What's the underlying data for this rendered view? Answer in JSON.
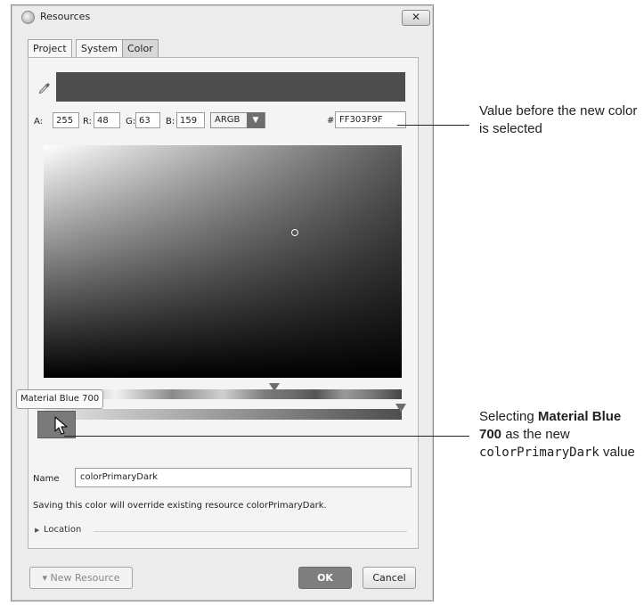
{
  "window": {
    "title": "Resources",
    "close_label": "✕"
  },
  "tabs": [
    {
      "label": "Project"
    },
    {
      "label": "System"
    },
    {
      "label": "Color",
      "selected": true
    }
  ],
  "color_picker": {
    "preview_color": "#4e4e4e",
    "channels": {
      "a_label": "A:",
      "a_value": "255",
      "r_label": "R:",
      "r_value": "48",
      "g_label": "G:",
      "g_value": "63",
      "b_label": "B:",
      "b_value": "159"
    },
    "mode": "ARGB",
    "hash_label": "#",
    "hex_value": "FF303F9F"
  },
  "tooltip": "Material Blue 700",
  "name_label": "Name",
  "name_value": "colorPrimaryDark",
  "warning_text": "Saving this color will override existing resource colorPrimaryDark.",
  "location_label": "Location",
  "buttons": {
    "new_resource": "▾ New Resource",
    "ok": "OK",
    "cancel": "Cancel"
  },
  "callouts": {
    "first": "Value before the new color is selected",
    "second_part1": "Selecting ",
    "second_bold": "Material Blue 700",
    "second_part2": " as the new ",
    "second_mono": "colorPrimaryDark",
    "second_part3": " value"
  }
}
